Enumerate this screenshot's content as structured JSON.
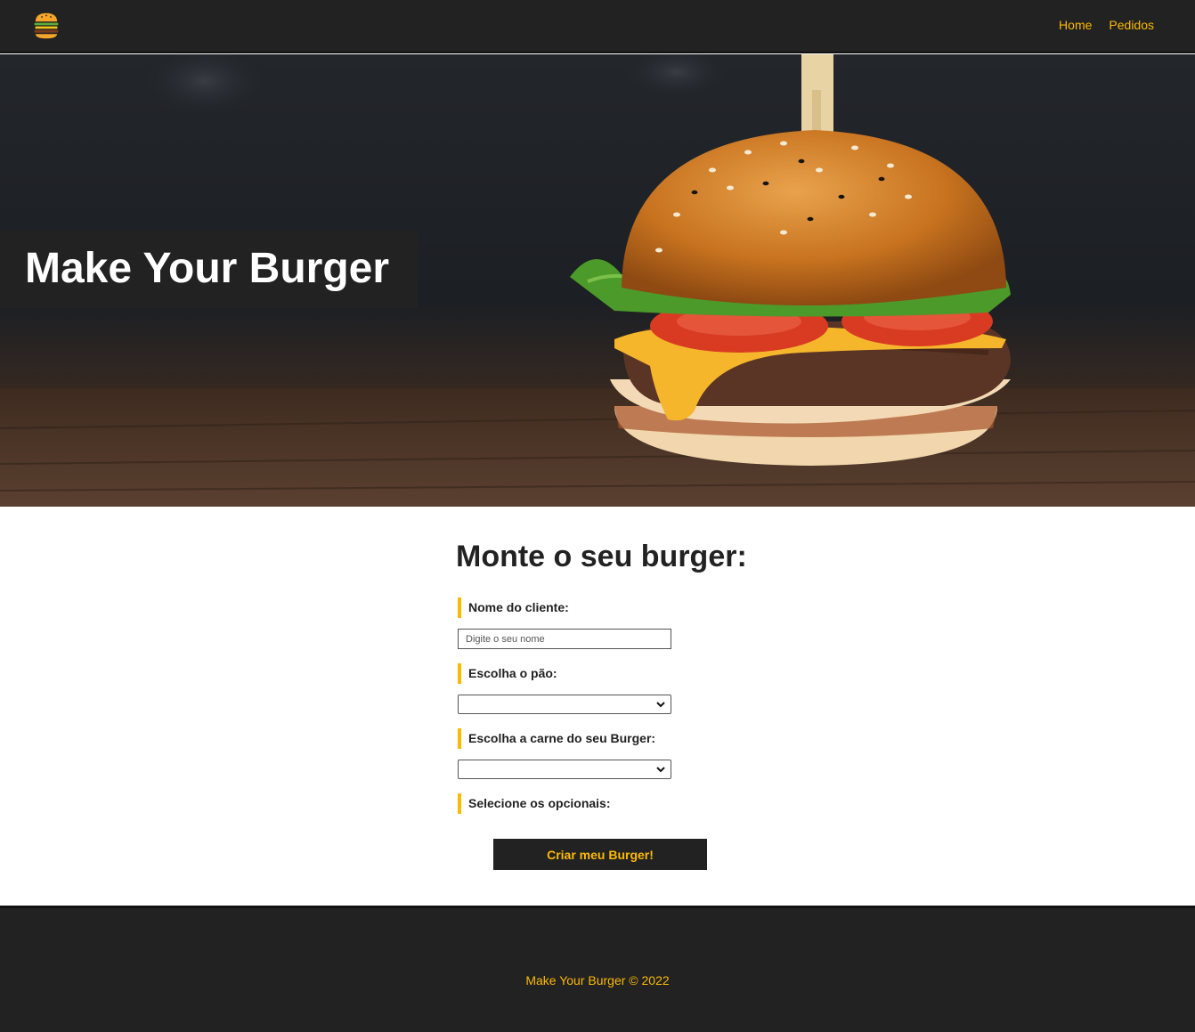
{
  "nav": {
    "logo_icon": "burger-icon",
    "links": [
      {
        "label": "Home"
      },
      {
        "label": "Pedidos"
      }
    ],
    "link_color": "#fcba03",
    "background": "#222222"
  },
  "hero": {
    "title": "Make Your Burger",
    "image_subject": "burger-photo"
  },
  "form": {
    "title": "Monte o seu burger:",
    "name_label": "Nome do cliente:",
    "name_placeholder": "Digite o seu nome",
    "name_value": "",
    "bread_label": "Escolha o pão:",
    "bread_value": "",
    "meat_label": "Escolha a carne do seu Burger:",
    "meat_value": "",
    "optionals_label": "Selecione os opcionais:",
    "submit_label": "Criar meu Burger!"
  },
  "footer": {
    "text": "Make Your Burger © 2022"
  },
  "colors": {
    "accent": "#fcba03",
    "dark": "#222222"
  }
}
